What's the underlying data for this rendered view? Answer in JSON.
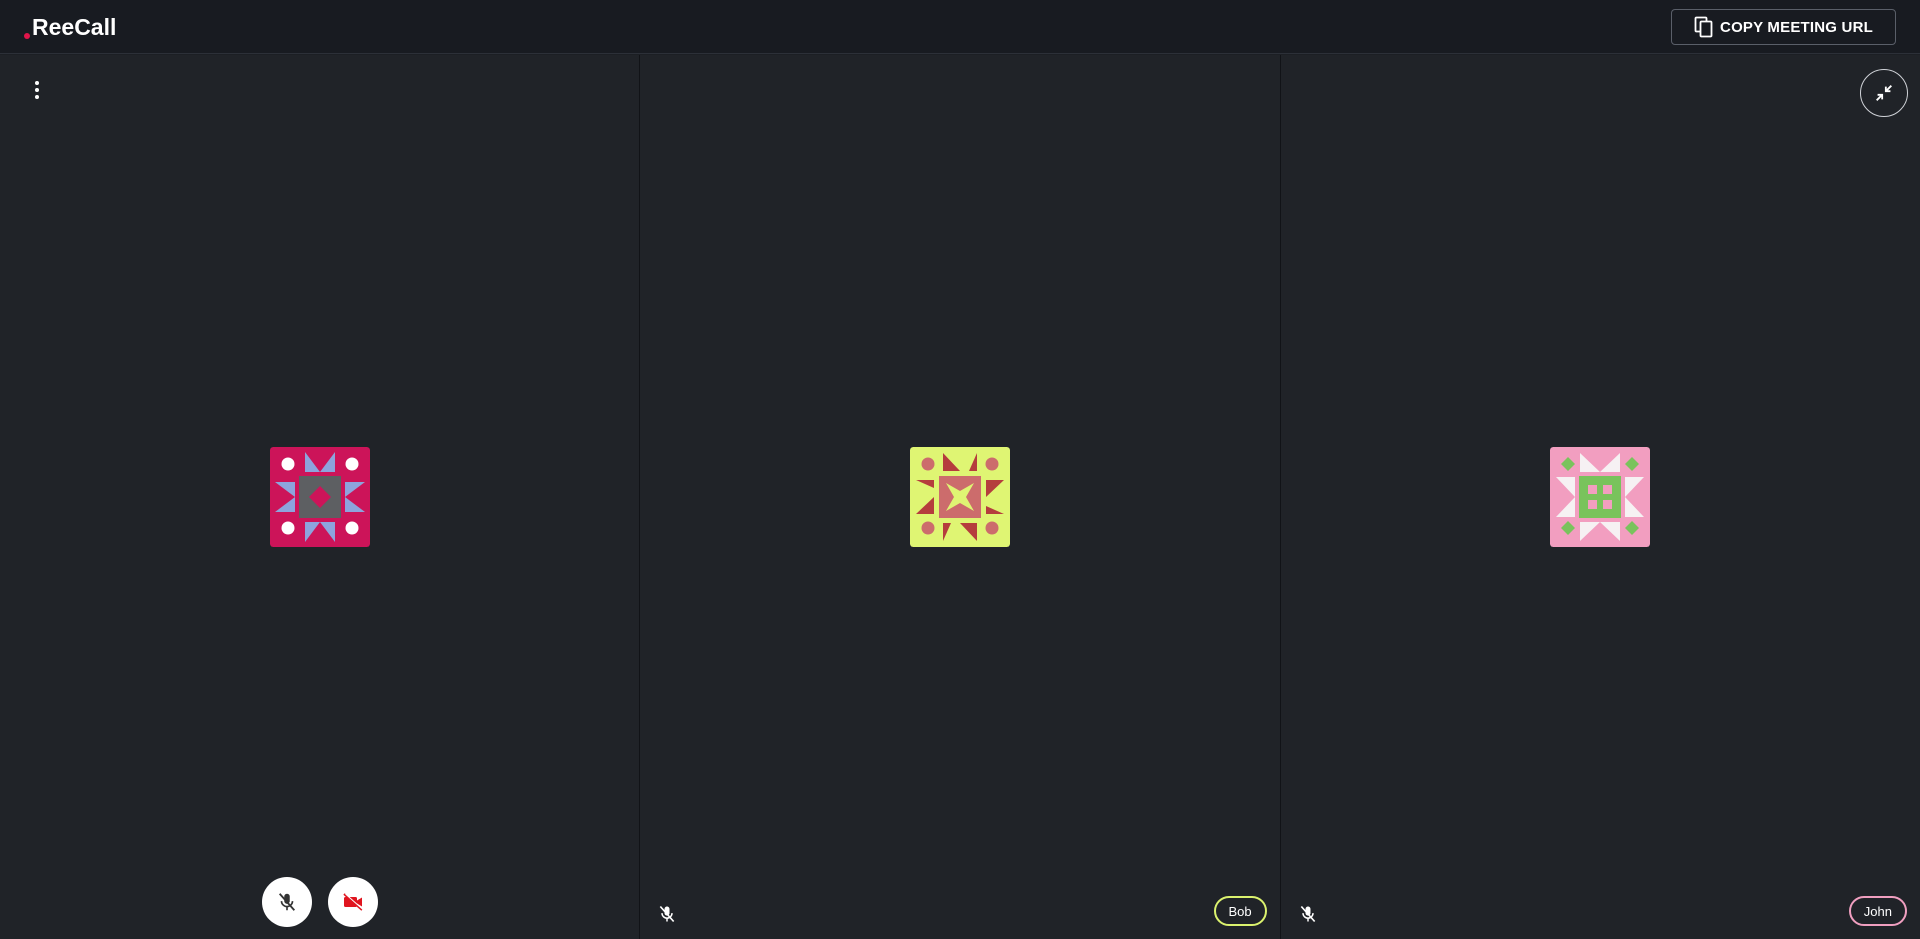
{
  "app": {
    "name": "ReeCall",
    "brand_color": "#e0154a"
  },
  "toolbar": {
    "copy_url_label": "COPY MEETING URL",
    "copy_icon": "copy-icon"
  },
  "participants": [
    {
      "id": "self",
      "avatar_bg": "#cc1459",
      "mic_muted": true,
      "camera_off": true,
      "menu_icon": "more-vertical-icon"
    },
    {
      "id": "bob",
      "name": "Bob",
      "avatar_bg": "#dff573",
      "badge_color": "#dbf26e",
      "mic_muted": true
    },
    {
      "id": "john",
      "name": "John",
      "avatar_bg": "#f29ec0",
      "badge_color": "#f09fc0",
      "mic_muted": true,
      "collapse_icon": "collapse-icon"
    }
  ],
  "controls": {
    "mic_icon": "mic-off-icon",
    "camera_icon": "video-off-icon",
    "camera_off_color": "#e0151f"
  }
}
